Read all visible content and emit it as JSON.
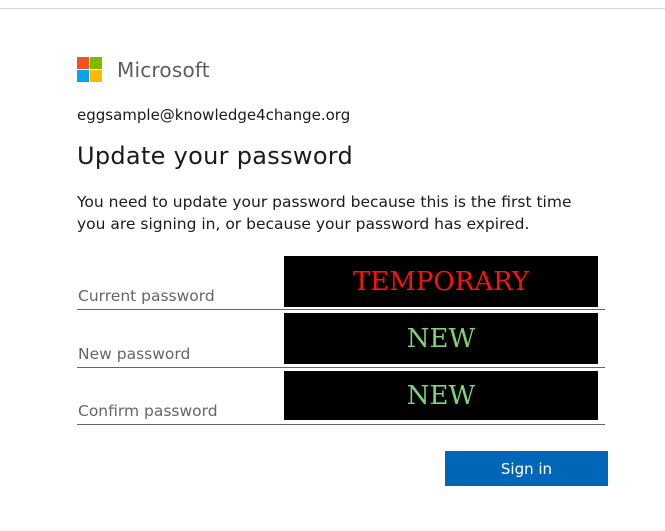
{
  "brand": {
    "name": "Microsoft",
    "logo_colors": {
      "red": "#f25022",
      "green": "#7fba00",
      "blue": "#00a4ef",
      "yellow": "#ffb900"
    }
  },
  "account": {
    "email": "eggsample@knowledge4change.org"
  },
  "page": {
    "title": "Update your password",
    "description": "You need to update your password because this is the first time you are signing in, or because your password has expired."
  },
  "form": {
    "fields": [
      {
        "label": "Current password",
        "overlay_text": "TEMPORARY",
        "overlay_color": "#ff1010"
      },
      {
        "label": "New password",
        "overlay_text": "NEW",
        "overlay_color": "#7fd37f"
      },
      {
        "label": "Confirm password",
        "overlay_text": "NEW",
        "overlay_color": "#7fd37f"
      }
    ],
    "submit_label": "Sign in",
    "submit_color": "#0067b8"
  }
}
